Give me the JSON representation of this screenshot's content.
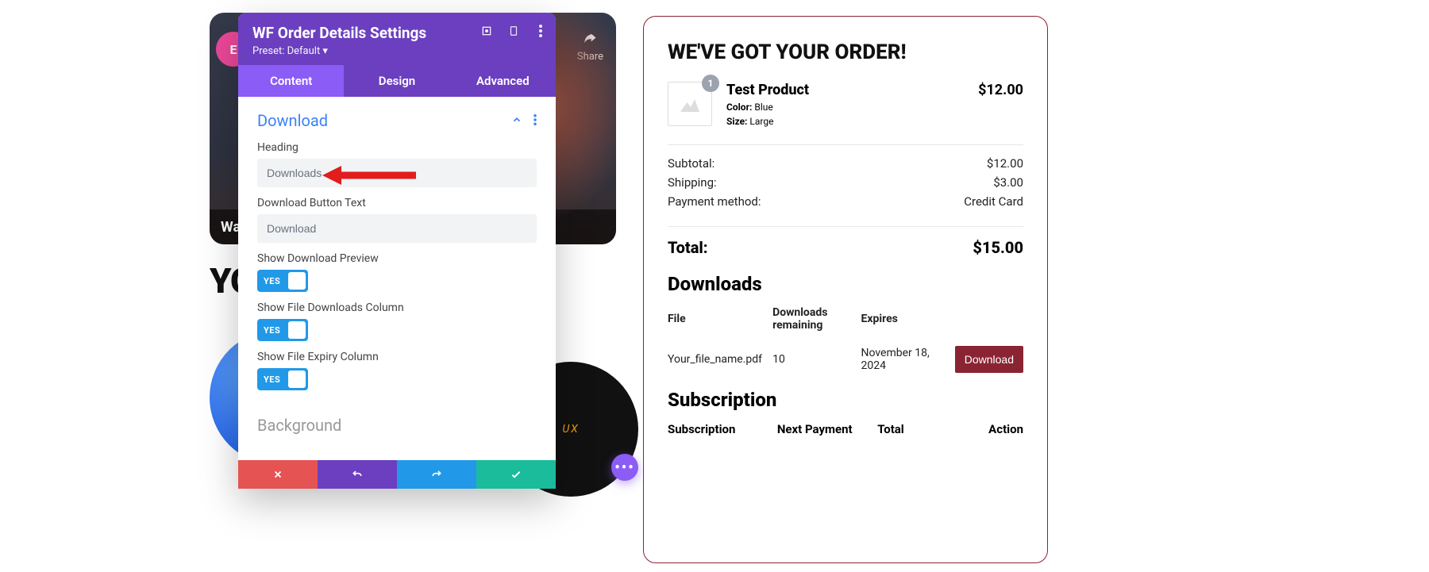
{
  "bg": {
    "bottom_bar": "Wat",
    "share": "Share",
    "logo": "E",
    "yo": "YO",
    "disc": "UX"
  },
  "panel": {
    "title": "WF Order Details Settings",
    "preset": "Preset: Default ▾",
    "tabs": {
      "content": "Content",
      "design": "Design",
      "advanced": "Advanced"
    },
    "section": "Download",
    "fields": {
      "heading_label": "Heading",
      "heading_value": "Downloads",
      "button_label": "Download Button Text",
      "button_value": "Download",
      "preview_label": "Show Download Preview",
      "col_label": "Show File Downloads Column",
      "expiry_label": "Show File Expiry Column",
      "yes": "YES"
    },
    "next_section": "Background"
  },
  "order": {
    "title": "WE'VE GOT YOUR ORDER!",
    "product": {
      "qty": "1",
      "name": "Test Product",
      "color_k": "Color:",
      "color_v": "Blue",
      "size_k": "Size:",
      "size_v": "Large",
      "price": "$12.00"
    },
    "summary": {
      "subtotal_k": "Subtotal:",
      "subtotal_v": "$12.00",
      "shipping_k": "Shipping:",
      "shipping_v": "$3.00",
      "payment_k": "Payment method:",
      "payment_v": "Credit Card",
      "total_k": "Total:",
      "total_v": "$15.00"
    },
    "downloads": {
      "heading": "Downloads",
      "cols": {
        "file": "File",
        "remaining": "Downloads remaining",
        "expires": "Expires",
        "action": ""
      },
      "row": {
        "file": "Your_file_name.pdf",
        "remaining": "10",
        "expires": "November 18, 2024",
        "btn": "Download"
      }
    },
    "subscription": {
      "heading": "Subscription",
      "cols": {
        "sub": "Subscription",
        "next": "Next Payment",
        "total": "Total",
        "action": "Action"
      }
    }
  }
}
